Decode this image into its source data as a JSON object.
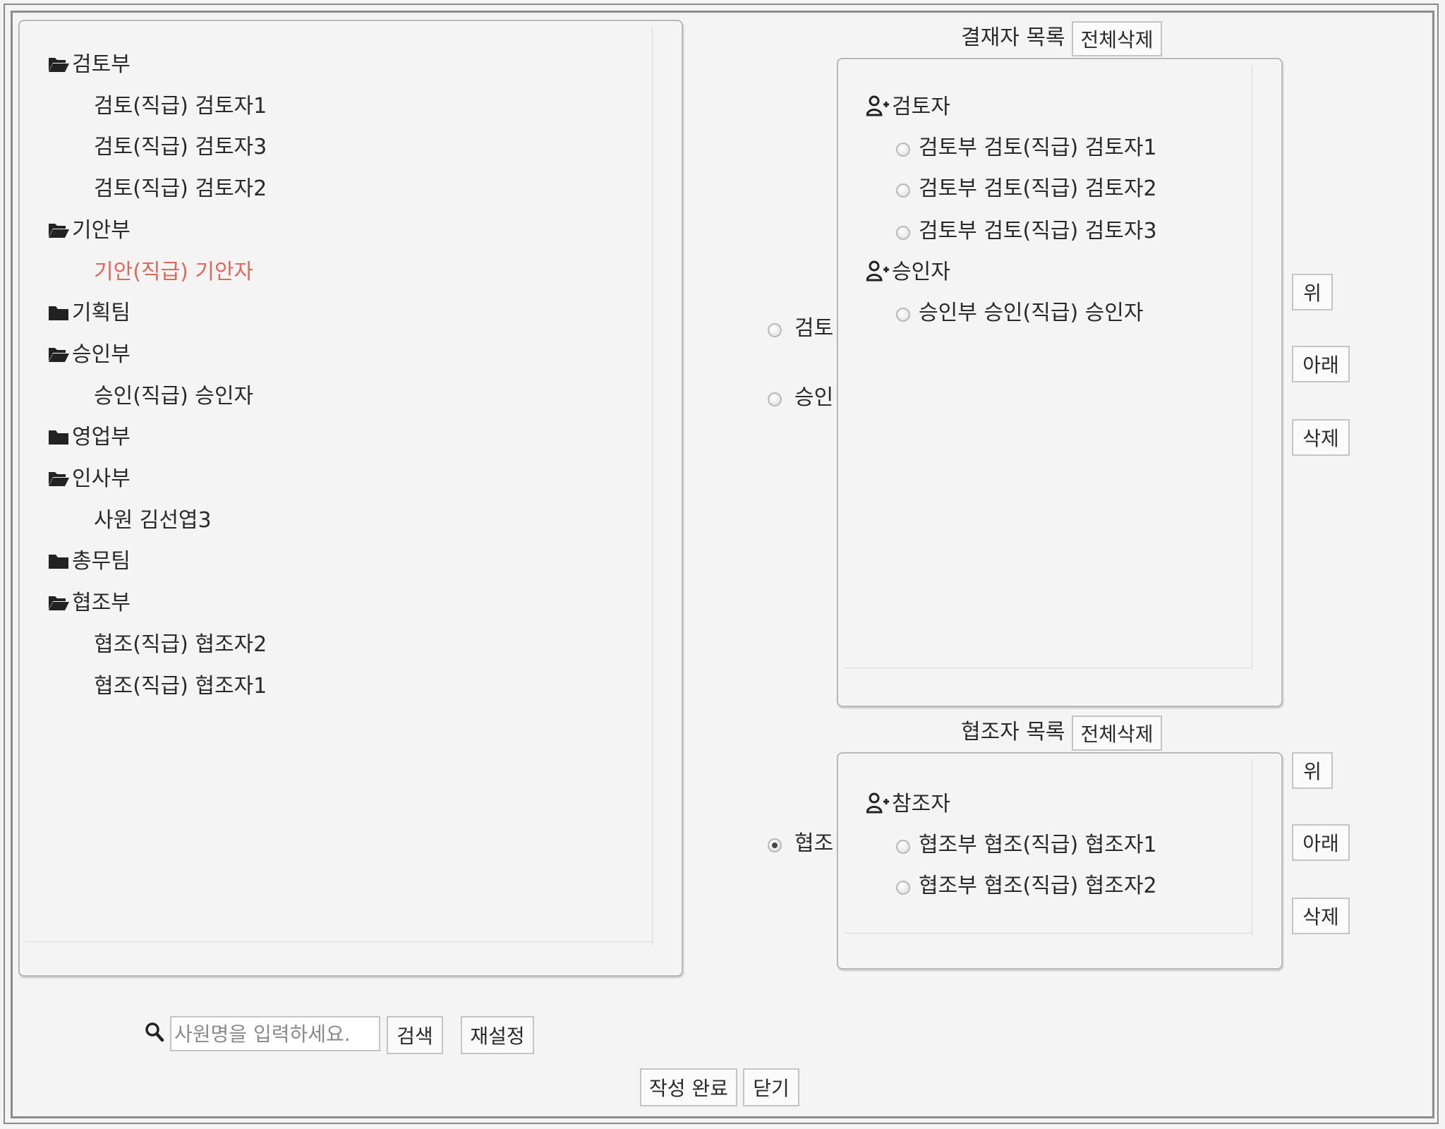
{
  "tree": {
    "items": [
      {
        "type": "folder",
        "label": "검토부",
        "open": true
      },
      {
        "type": "member",
        "label": "검토(직급) 검토자1"
      },
      {
        "type": "member",
        "label": "검토(직급) 검토자3"
      },
      {
        "type": "member",
        "label": "검토(직급) 검토자2"
      },
      {
        "type": "folder",
        "label": "기안부",
        "open": true
      },
      {
        "type": "member",
        "label": "기안(직급) 기안자",
        "selected": true
      },
      {
        "type": "folder",
        "label": "기획팀",
        "open": false
      },
      {
        "type": "folder",
        "label": "승인부",
        "open": true
      },
      {
        "type": "member",
        "label": "승인(직급) 승인자"
      },
      {
        "type": "folder",
        "label": "영업부",
        "open": false
      },
      {
        "type": "folder",
        "label": "인사부",
        "open": true
      },
      {
        "type": "member",
        "label": "사원 김선엽3"
      },
      {
        "type": "folder",
        "label": "총무팀",
        "open": false
      },
      {
        "type": "folder",
        "label": "협조부",
        "open": true
      },
      {
        "type": "member",
        "label": "협조(직급) 협조자2"
      },
      {
        "type": "member",
        "label": "협조(직급) 협조자1"
      }
    ]
  },
  "type_radios": {
    "review": {
      "label": "검토",
      "checked": false
    },
    "approve": {
      "label": "승인",
      "checked": false
    },
    "cooperate": {
      "label": "협조",
      "checked": true
    }
  },
  "approver_list": {
    "title": "결재자 목록",
    "clear_all": "전체삭제",
    "groups": [
      {
        "label": "검토자",
        "entries": [
          "검토부 검토(직급) 검토자1",
          "검토부 검토(직급) 검토자2",
          "검토부 검토(직급) 검토자3"
        ]
      },
      {
        "label": "승인자",
        "entries": [
          "승인부 승인(직급) 승인자"
        ]
      }
    ],
    "up": "위",
    "down": "아래",
    "delete": "삭제"
  },
  "cooperator_list": {
    "title": "협조자 목록",
    "clear_all": "전체삭제",
    "groups": [
      {
        "label": "참조자",
        "entries": [
          "협조부 협조(직급) 협조자1",
          "협조부 협조(직급) 협조자2"
        ]
      }
    ],
    "up": "위",
    "down": "아래",
    "delete": "삭제"
  },
  "search": {
    "placeholder": "사원명을 입력하세요.",
    "search_button": "검색",
    "reset_button": "재설정"
  },
  "footer": {
    "complete_button": "작성 완료",
    "close_button": "닫기"
  },
  "colors": {
    "selected_member": "#e2675b"
  }
}
